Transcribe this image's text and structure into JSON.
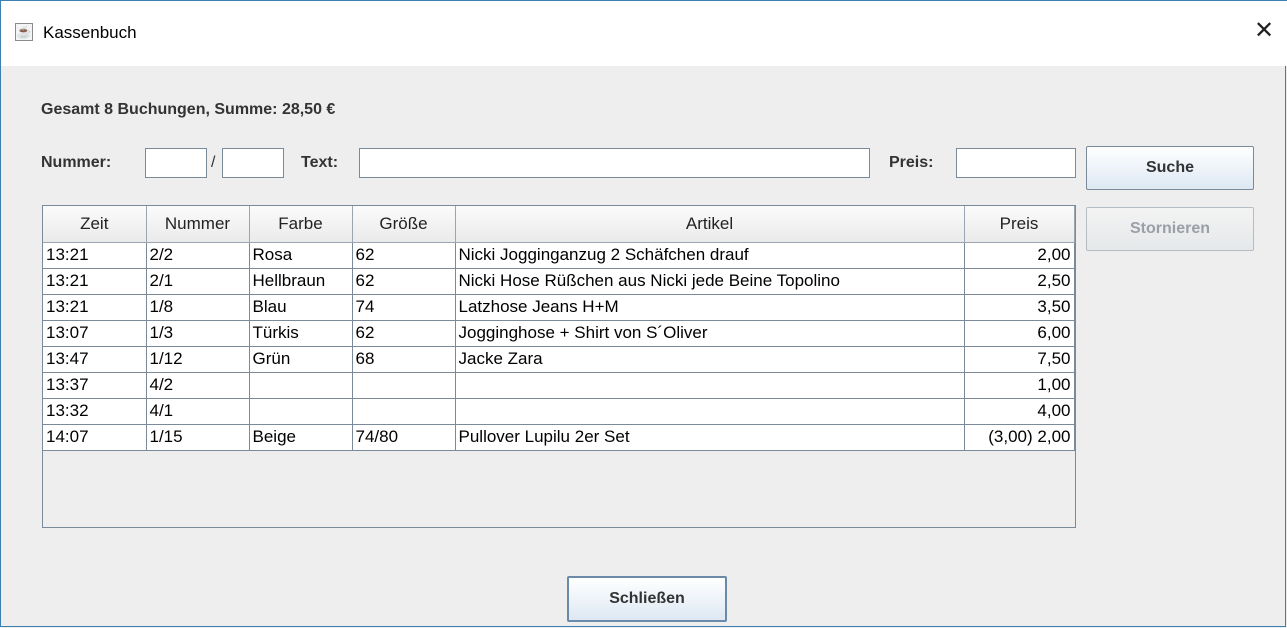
{
  "window": {
    "title": "Kassenbuch",
    "close_glyph": "✕",
    "icon": "java-icon"
  },
  "summary": "Gesamt 8 Buchungen, Summe: 28,50 €",
  "search": {
    "nummer_label": "Nummer:",
    "separator": "/",
    "nummer_a": "",
    "nummer_b": "",
    "text_label": "Text:",
    "text_value": "",
    "preis_label": "Preis:",
    "preis_value": ""
  },
  "buttons": {
    "suche": "Suche",
    "stornieren": "Stornieren",
    "schliessen": "Schließen"
  },
  "table": {
    "headers": [
      "Zeit",
      "Nummer",
      "Farbe",
      "Größe",
      "Artikel",
      "Preis"
    ],
    "rows": [
      [
        "13:21",
        "2/2",
        "Rosa",
        "62",
        "Nicki Jogginganzug 2 Schäfchen drauf",
        "2,00"
      ],
      [
        "13:21",
        "2/1",
        "Hellbraun",
        "62",
        "Nicki Hose Rüßchen aus Nicki jede Beine Topolino",
        "2,50"
      ],
      [
        "13:21",
        "1/8",
        "Blau",
        "74",
        "Latzhose Jeans H+M",
        "3,50"
      ],
      [
        "13:07",
        "1/3",
        "Türkis",
        "62",
        "Jogginghose + Shirt von S´Oliver",
        "6,00"
      ],
      [
        "13:47",
        "1/12",
        "Grün",
        "68",
        "Jacke Zara",
        "7,50"
      ],
      [
        "13:37",
        "4/2",
        "",
        "",
        "",
        "1,00"
      ],
      [
        "13:32",
        "4/1",
        "",
        "",
        "",
        "4,00"
      ],
      [
        "14:07",
        "1/15",
        "Beige",
        "74/80",
        "Pullover Lupilu 2er Set",
        "(3,00) 2,00"
      ]
    ]
  }
}
